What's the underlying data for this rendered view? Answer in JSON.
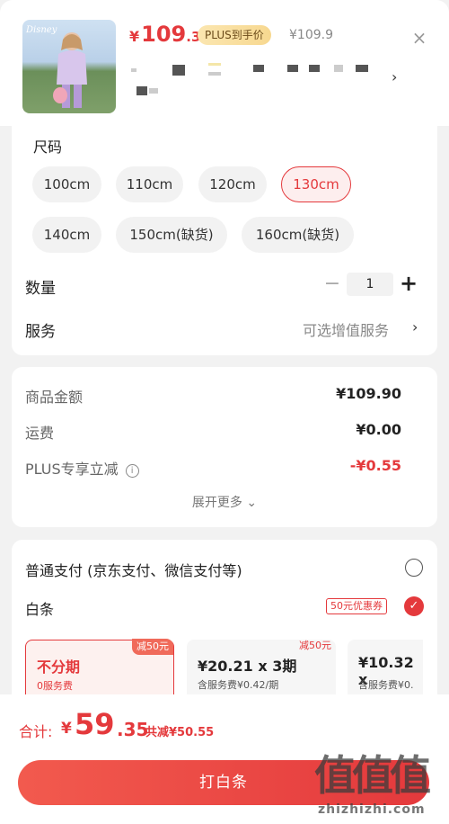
{
  "product": {
    "brand_text": "Disney",
    "price_currency": "¥",
    "price_int": "109",
    "price_dec": ".35",
    "plus_badge": "PLUS到手价",
    "original_price": "¥109.9",
    "close_symbol": "×",
    "detail_chevron": "›"
  },
  "size": {
    "label": "尺码",
    "options": [
      {
        "label": "100cm",
        "selected": false
      },
      {
        "label": "110cm",
        "selected": false
      },
      {
        "label": "120cm",
        "selected": false
      },
      {
        "label": "130cm",
        "selected": true
      },
      {
        "label": "140cm",
        "selected": false
      },
      {
        "label": "150cm(缺货)",
        "selected": false
      },
      {
        "label": "160cm(缺货)",
        "selected": false
      }
    ]
  },
  "quantity": {
    "label": "数量",
    "value": "1",
    "minus_symbol": "−",
    "plus_symbol": "+"
  },
  "service": {
    "label": "服务",
    "value": "可选增值服务",
    "chevron": "›"
  },
  "summary": {
    "goods_label": "商品金额",
    "goods_value": "¥109.90",
    "shipping_label": "运费",
    "shipping_value": "¥0.00",
    "plus_label": "PLUS专享立减",
    "plus_info": "i",
    "plus_value": "-¥0.55",
    "expand_label": "展开更多 ⌄"
  },
  "payment": {
    "normal_label": "普通支付 (京东支付、微信支付等)",
    "baitiao_label": "白条",
    "coupon_tag": "50元优惠券",
    "check_symbol": "✓",
    "installments": [
      {
        "title": "不分期",
        "sub": "0服务费",
        "badge": "减50元",
        "selected": true
      },
      {
        "title": "¥20.21 x 3期",
        "sub": "含服务费¥0.42/期",
        "badge": "减50元",
        "selected": false
      },
      {
        "title": "¥10.32 x",
        "sub": "含服务费¥0.",
        "badge": "",
        "selected": false
      }
    ]
  },
  "footer": {
    "total_label": "合计:",
    "total_currency": "¥",
    "total_int": "59",
    "total_dec": ".35",
    "saving": "共减¥50.55",
    "pay_button": "打白条",
    "watermark_glyphs": "值值值",
    "watermark_url": "zhizhizhi.com"
  },
  "colors": {
    "accent": "#e4393c",
    "plus_badge_bg": "#f7d890",
    "background": "#f2f2f2"
  }
}
